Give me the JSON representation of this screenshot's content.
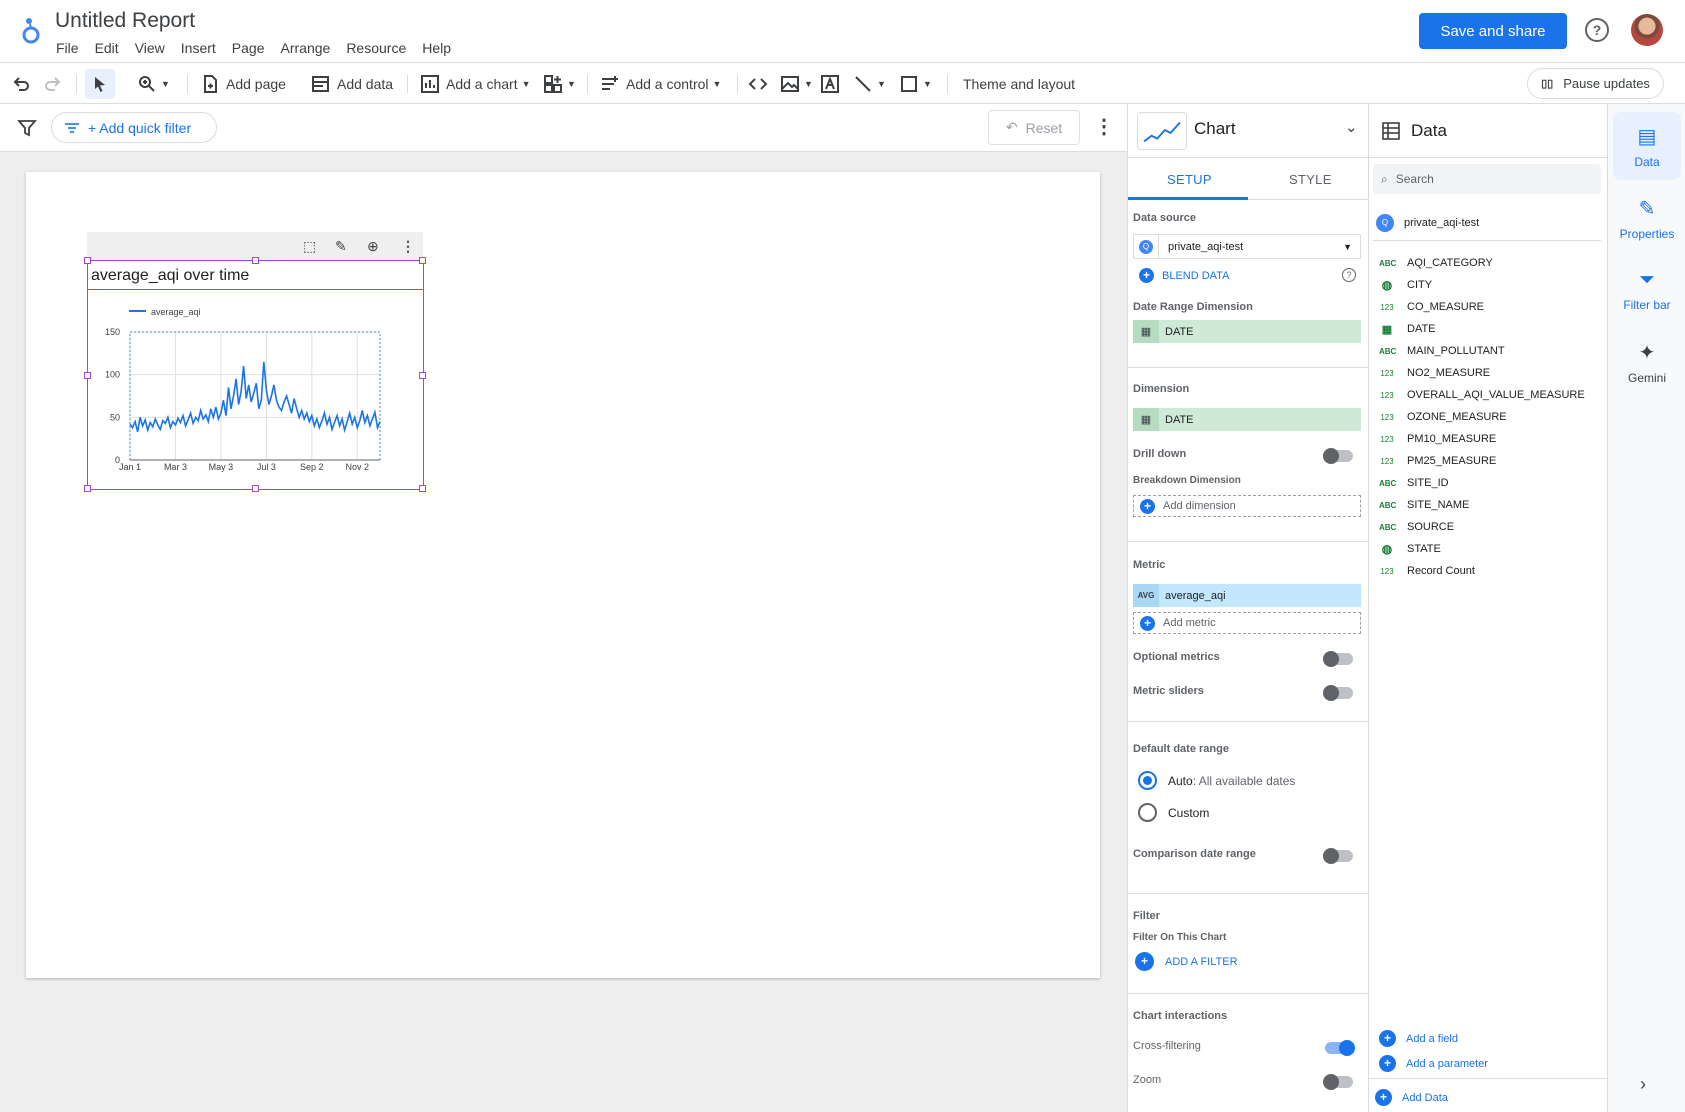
{
  "header": {
    "title": "Untitled Report",
    "menu": [
      "File",
      "Edit",
      "View",
      "Insert",
      "Page",
      "Arrange",
      "Resource",
      "Help"
    ],
    "save_share": "Save and share",
    "help": "?"
  },
  "toolbar": {
    "add_page": "Add page",
    "add_data": "Add data",
    "add_chart": "Add a chart",
    "add_control": "Add a control",
    "theme_layout": "Theme and layout",
    "pause_updates": "Pause updates"
  },
  "filterbar": {
    "quick_filter": "+ Add quick filter",
    "reset": "Reset"
  },
  "chart": {
    "title": "average_aqi over time"
  },
  "chart_data": {
    "type": "line",
    "title": "average_aqi over time",
    "xlabel": "",
    "ylabel": "",
    "legend": "average_aqi",
    "legend_position": "top-left",
    "x_ticks": [
      "Jan 1",
      "Mar 3",
      "May 3",
      "Jul 3",
      "Sep 2",
      "Nov 2"
    ],
    "y_ticks": [
      0,
      50,
      100,
      150
    ],
    "ylim": [
      0,
      150
    ],
    "grid": true,
    "series": [
      {
        "name": "average_aqi",
        "color": "#1a73e8",
        "x_domain": [
          "Jan 1",
          "Dec 31"
        ],
        "values": [
          42,
          38,
          45,
          33,
          50,
          40,
          47,
          35,
          44,
          39,
          48,
          41,
          36,
          46,
          43,
          50,
          38,
          45,
          41,
          49,
          44,
          52,
          40,
          47,
          55,
          43,
          50,
          46,
          58,
          48,
          53,
          45,
          60,
          50,
          62,
          48,
          55,
          70,
          52,
          85,
          60,
          75,
          95,
          65,
          80,
          110,
          72,
          88,
          68,
          78,
          90,
          60,
          70,
          115,
          82,
          65,
          75,
          88,
          70,
          62,
          58,
          68,
          75,
          65,
          55,
          72,
          60,
          50,
          58,
          48,
          55,
          45,
          52,
          40,
          48,
          38,
          46,
          55,
          42,
          50,
          36,
          44,
          52,
          40,
          48,
          35,
          45,
          55,
          42,
          50,
          38,
          46,
          58,
          44,
          52,
          40,
          48,
          56,
          38,
          45
        ]
      }
    ]
  },
  "chart_panel": {
    "title": "Chart",
    "tab_setup": "SETUP",
    "tab_style": "STYLE",
    "data_source_label": "Data source",
    "data_source": "private_aqi-test",
    "blend_data": "BLEND DATA",
    "date_range_dim_label": "Date Range Dimension",
    "date_range_dim": "DATE",
    "dimension_label": "Dimension",
    "dimension": "DATE",
    "drill_down": "Drill down",
    "breakdown_label": "Breakdown Dimension",
    "add_dimension": "Add dimension",
    "metric_label": "Metric",
    "metric_agg": "AVG",
    "metric": "average_aqi",
    "add_metric": "Add metric",
    "optional_metrics": "Optional metrics",
    "metric_sliders": "Metric sliders",
    "default_date_range": "Default date range",
    "auto": "Auto",
    "auto_sub": ": All available dates",
    "custom": "Custom",
    "comparison": "Comparison date range",
    "filter_label": "Filter",
    "filter_on_chart": "Filter On This Chart",
    "add_filter": "ADD A FILTER",
    "interactions_label": "Chart interactions",
    "cross_filtering": "Cross-filtering",
    "zoom": "Zoom"
  },
  "data_panel": {
    "title": "Data",
    "search_placeholder": "Search",
    "source": "private_aqi-test",
    "fields": [
      {
        "type": "ABC",
        "name": "AQI_CATEGORY"
      },
      {
        "type": "geo",
        "name": "CITY"
      },
      {
        "type": "123",
        "name": "CO_MEASURE"
      },
      {
        "type": "date",
        "name": "DATE"
      },
      {
        "type": "ABC",
        "name": "MAIN_POLLUTANT"
      },
      {
        "type": "123",
        "name": "NO2_MEASURE"
      },
      {
        "type": "123",
        "name": "OVERALL_AQI_VALUE_MEASURE"
      },
      {
        "type": "123",
        "name": "OZONE_MEASURE"
      },
      {
        "type": "123",
        "name": "PM10_MEASURE"
      },
      {
        "type": "123",
        "name": "PM25_MEASURE"
      },
      {
        "type": "ABC",
        "name": "SITE_ID"
      },
      {
        "type": "ABC",
        "name": "SITE_NAME"
      },
      {
        "type": "ABC",
        "name": "SOURCE"
      },
      {
        "type": "geo",
        "name": "STATE"
      },
      {
        "type": "123",
        "name": "Record Count"
      }
    ],
    "add_field": "Add a field",
    "add_parameter": "Add a parameter",
    "add_data": "Add Data"
  },
  "rail": {
    "data": "Data",
    "properties": "Properties",
    "filter_bar": "Filter bar",
    "gemini": "Gemini"
  }
}
